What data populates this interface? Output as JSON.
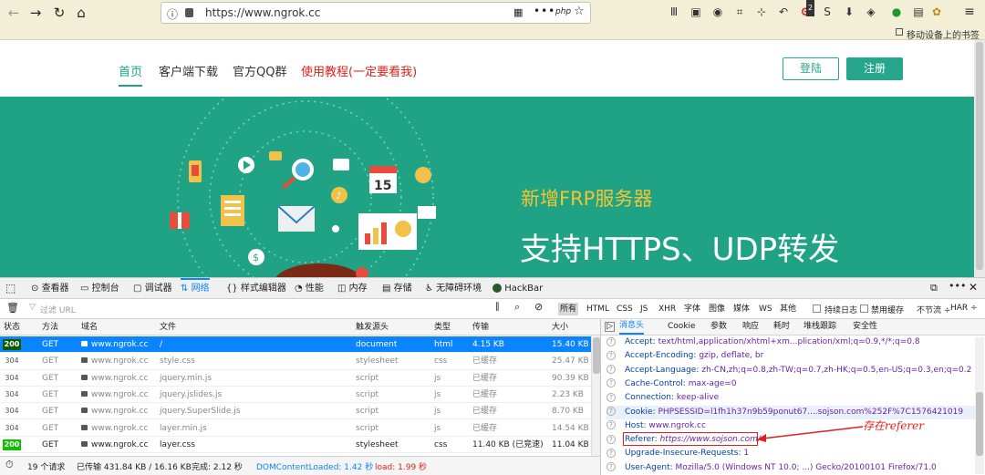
{
  "browser": {
    "url": "https://www.ngrok.cc",
    "url_action_php": "php",
    "ext_badge": "2",
    "extension_text": "移动设备上的书签"
  },
  "site": {
    "nav": [
      "首页",
      "客户端下载",
      "官方QQ群",
      "使用教程(一定要看我)"
    ],
    "login_label": "登陆",
    "register_label": "注册",
    "banner_subtitle": "新增FRP服务器",
    "banner_title": "支持HTTPS、UDP转发",
    "calendar_day": "15"
  },
  "devtools": {
    "tabs": [
      "查看器",
      "控制台",
      "调试器",
      "网络",
      "样式编辑器",
      "性能",
      "内存",
      "存储",
      "无障碍环境",
      "HackBar"
    ],
    "filter_placeholder": "过滤 URL",
    "type_filters": [
      "所有",
      "HTML",
      "CSS",
      "JS",
      "XHR",
      "字体",
      "图像",
      "媒体",
      "WS",
      "其他"
    ],
    "persist_log": "持续日志",
    "disable_cache": "禁用缓存",
    "throttle": "不节流 ÷",
    "har": "HAR ÷",
    "columns": [
      "状态",
      "方法",
      "域名",
      "文件",
      "触发源头",
      "类型",
      "传输",
      "大小"
    ],
    "requests": [
      {
        "status": "200",
        "method": "GET",
        "domain": "www.ngrok.cc",
        "file": "/",
        "cause": "document",
        "type": "html",
        "transfer": "4.15 KB",
        "size": "15.40 KB"
      },
      {
        "status": "304",
        "method": "GET",
        "domain": "www.ngrok.cc",
        "file": "style.css",
        "cause": "stylesheet",
        "type": "css",
        "transfer": "已缓存",
        "size": "25.47 KB"
      },
      {
        "status": "304",
        "method": "GET",
        "domain": "www.ngrok.cc",
        "file": "jquery.min.js",
        "cause": "script",
        "type": "js",
        "transfer": "已缓存",
        "size": "90.39 KB"
      },
      {
        "status": "304",
        "method": "GET",
        "domain": "www.ngrok.cc",
        "file": "jquery.jslides.js",
        "cause": "script",
        "type": "js",
        "transfer": "已缓存",
        "size": "2.23 KB"
      },
      {
        "status": "304",
        "method": "GET",
        "domain": "www.ngrok.cc",
        "file": "jquery.SuperSlide.js",
        "cause": "script",
        "type": "js",
        "transfer": "已缓存",
        "size": "8.70 KB"
      },
      {
        "status": "304",
        "method": "GET",
        "domain": "www.ngrok.cc",
        "file": "layer.min.js",
        "cause": "script",
        "type": "js",
        "transfer": "已缓存",
        "size": "14.54 KB"
      },
      {
        "status": "200",
        "method": "GET",
        "domain": "www.ngrok.cc",
        "file": "layer.css",
        "cause": "stylesheet",
        "type": "css",
        "transfer": "11.40 KB (已竞速)",
        "size": "11.04 KB"
      }
    ],
    "status": {
      "count": "19 个请求",
      "transferred": "已传输 431.84 KB / 16.16 KB",
      "finish": "完成: 2.12 秒",
      "dcl": "DOMContentLoaded: 1.42 秒",
      "load": "load: 1.99 秒"
    },
    "detail_tabs": [
      "消息头",
      "Cookie",
      "参数",
      "响应",
      "耗时",
      "堆栈跟踪",
      "安全性"
    ],
    "headers": [
      {
        "key": "Accept:",
        "value": "text/html,application/xhtml+xm...plication/xml;q=0.9,*/*;q=0.8"
      },
      {
        "key": "Accept-Encoding:",
        "value": "gzip, deflate, br"
      },
      {
        "key": "Accept-Language:",
        "value": "zh-CN,zh;q=0.8,zh-TW;q=0.7,zh-HK;q=0.5,en-US;q=0.3,en;q=0.2"
      },
      {
        "key": "Cache-Control:",
        "value": "max-age=0"
      },
      {
        "key": "Connection:",
        "value": "keep-alive"
      },
      {
        "key": "Cookie:",
        "value": "PHPSESSID=l1fh1h37n9b59ponut67....sojson.com%252F%7C1576421019"
      },
      {
        "key": "Host:",
        "value": "www.ngrok.cc"
      },
      {
        "key": "Referer:",
        "value": "https://www.sojson.com/"
      },
      {
        "key": "Upgrade-Insecure-Requests:",
        "value": "1"
      },
      {
        "key": "User-Agent:",
        "value": "Mozilla/5.0 (Windows NT 10.0; ...) Gecko/20100101 Firefox/71.0"
      }
    ],
    "annotation": "存在referer"
  },
  "colors": {
    "brand_green": "#1fa384",
    "accent_blue": "#0a84ff",
    "annotation_red": "#e0201a",
    "banner_yellow": "#f3c431"
  }
}
